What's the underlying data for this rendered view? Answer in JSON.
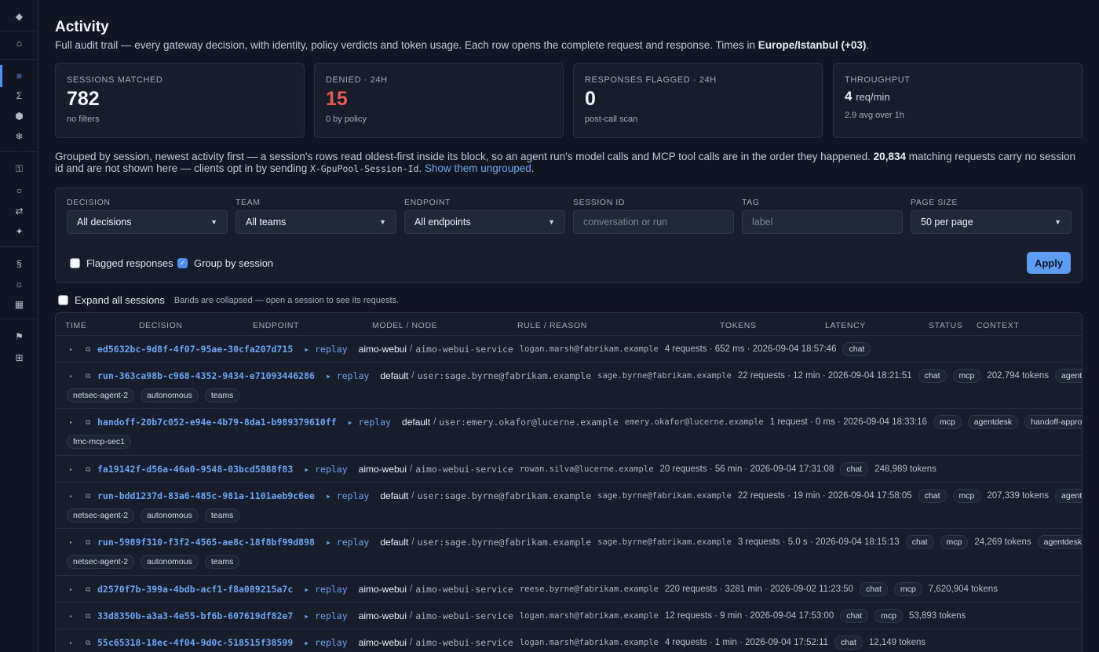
{
  "sidebar": {
    "icons": [
      "logo-icon",
      "home-icon",
      "activity-icon",
      "sigma-icon",
      "hexagon-icon",
      "gear-icon",
      "key-icon",
      "circle-icon",
      "swap-icon",
      "sparkle-icon",
      "section-icon",
      "settings-icon",
      "grid-icon",
      "flag-icon",
      "apps-icon"
    ],
    "glyphs": [
      "◆",
      "⌂",
      "≡",
      "Σ",
      "⬢",
      "❄",
      "⚿",
      "○",
      "⇄",
      "✦",
      "§",
      "☼",
      "▦",
      "⚑",
      "⊞"
    ]
  },
  "page": {
    "title": "Activity",
    "subtitle_main": "Full audit trail — every gateway decision, with identity, policy verdicts and token usage. Each row opens the complete request and response. Times in ",
    "subtitle_tz": "Europe/Istanbul (+03)",
    "subtitle_end": "."
  },
  "stats": [
    {
      "label": "SESSIONS MATCHED",
      "value": "782",
      "note": "no filters"
    },
    {
      "label": "DENIED · 24H",
      "value": "15",
      "note": "0 by policy"
    },
    {
      "label": "RESPONSES FLAGGED · 24H",
      "value": "0",
      "note": "post-call scan"
    },
    {
      "label": "THROUGHPUT",
      "value": "4",
      "unit": "req/min",
      "note": "2.9 avg over 1h"
    }
  ],
  "grouped": {
    "text1": "Grouped by session, newest activity first — a session's rows read oldest-first inside its block, so an agent run's model calls and MCP tool calls are in the order they happened. ",
    "count": "20,834",
    "text2": " matching requests carry no session id and are not shown here — clients opt in by sending ",
    "header": "X-GpuPool-Session-Id",
    "text3": ". ",
    "link": "Show them ungrouped",
    "text4": "."
  },
  "filters": {
    "decision": {
      "label": "DECISION",
      "value": "All decisions"
    },
    "team": {
      "label": "TEAM",
      "value": "All teams"
    },
    "endpoint": {
      "label": "ENDPOINT",
      "value": "All endpoints"
    },
    "session": {
      "label": "SESSION ID",
      "placeholder": "conversation or run"
    },
    "tag": {
      "label": "TAG",
      "placeholder": "label"
    },
    "page_size": {
      "label": "PAGE SIZE",
      "value": "50 per page"
    },
    "flagged_label": "Flagged responses",
    "flagged_checked": false,
    "group_label": "Group by session",
    "group_checked": true,
    "apply": "Apply"
  },
  "expand": {
    "label": "Expand all sessions",
    "note": "Bands are collapsed — open a session to see its requests."
  },
  "table": {
    "headers": [
      "TIME",
      "DECISION",
      "ENDPOINT",
      "MODEL / NODE",
      "RULE / REASON",
      "TOKENS",
      "LATENCY",
      "STATUS",
      "CONTEXT"
    ],
    "rows": [
      {
        "id": "ed5632bc-9d8f-4f07-95ae-30cfa207d715",
        "replay": "▸ replay",
        "model": "aimo-webui",
        "node": "aimo-webui-service",
        "email": "logan.marsh@fabrikam.example",
        "meta": "4 requests · 652 ms · 2026-09-04 18:57:46",
        "tags1": [
          "chat"
        ],
        "tokens": "",
        "tags1b": [],
        "tags2": []
      },
      {
        "id": "run-363ca98b-c968-4352-9434-e71093446286",
        "replay": "▸ replay",
        "model": "default",
        "node": "user:sage.byrne@fabrikam.example",
        "email": "sage.byrne@fabrikam.example",
        "meta": "22 requests · 12 min · 2026-09-04 18:21:51",
        "tags1": [
          "chat",
          "mcp"
        ],
        "tokens": "202,794 tokens",
        "tags1b": [
          "agentdesk"
        ],
        "tags2": [
          "netsec-agent-2",
          "autonomous",
          "teams"
        ]
      },
      {
        "id": "handoff-20b7c052-e94e-4b79-8da1-b989379610ff",
        "replay": "▸ replay",
        "model": "default",
        "node": "user:emery.okafor@lucerne.example",
        "email": "emery.okafor@lucerne.example",
        "meta": "1 request · 0 ms · 2026-09-04 18:33:16",
        "tags1": [
          "mcp",
          "agentdesk",
          "handoff-approve"
        ],
        "tokens": "",
        "tags1b": [],
        "tags2": [
          "fmc-mcp-sec1"
        ]
      },
      {
        "id": "fa19142f-d56a-46a0-9548-03bcd5888f83",
        "replay": "▸ replay",
        "model": "aimo-webui",
        "node": "aimo-webui-service",
        "email": "rowan.silva@lucerne.example",
        "meta": "20 requests · 56 min · 2026-09-04 17:31:08",
        "tags1": [
          "chat"
        ],
        "tokens": "248,989 tokens",
        "tags1b": [],
        "tags2": []
      },
      {
        "id": "run-bdd1237d-83a6-485c-981a-1101aeb9c6ee",
        "replay": "▸ replay",
        "model": "default",
        "node": "user:sage.byrne@fabrikam.example",
        "email": "sage.byrne@fabrikam.example",
        "meta": "22 requests · 19 min · 2026-09-04 17:58:05",
        "tags1": [
          "chat",
          "mcp"
        ],
        "tokens": "207,339 tokens",
        "tags1b": [
          "agentdesk"
        ],
        "tags2": [
          "netsec-agent-2",
          "autonomous",
          "teams"
        ]
      },
      {
        "id": "run-5989f310-f3f2-4565-ae8c-18f8bf99d898",
        "replay": "▸ replay",
        "model": "default",
        "node": "user:sage.byrne@fabrikam.example",
        "email": "sage.byrne@fabrikam.example",
        "meta": "3 requests · 5.0 s · 2026-09-04 18:15:13",
        "tags1": [
          "chat",
          "mcp"
        ],
        "tokens": "24,269 tokens",
        "tags1b": [
          "agentdesk"
        ],
        "tags2": [
          "netsec-agent-2",
          "autonomous",
          "teams"
        ]
      },
      {
        "id": "d2570f7b-399a-4bdb-acf1-f8a089215a7c",
        "replay": "▸ replay",
        "model": "aimo-webui",
        "node": "aimo-webui-service",
        "email": "reese.byrne@fabrikam.example",
        "meta": "220 requests · 3281 min · 2026-09-02 11:23:50",
        "tags1": [
          "chat",
          "mcp"
        ],
        "tokens": "7,620,904 tokens",
        "tags1b": [],
        "tags2": []
      },
      {
        "id": "33d8350b-a3a3-4e55-bf6b-607619df82e7",
        "replay": "▸ replay",
        "model": "aimo-webui",
        "node": "aimo-webui-service",
        "email": "logan.marsh@fabrikam.example",
        "meta": "12 requests · 9 min · 2026-09-04 17:53:00",
        "tags1": [
          "chat",
          "mcp"
        ],
        "tokens": "53,893 tokens",
        "tags1b": [],
        "tags2": []
      },
      {
        "id": "55c65318-18ec-4f04-9d0c-518515f38599",
        "replay": "▸ replay",
        "model": "aimo-webui",
        "node": "aimo-webui-service",
        "email": "logan.marsh@fabrikam.example",
        "meta": "4 requests · 1 min · 2026-09-04 17:52:11",
        "tags1": [
          "chat"
        ],
        "tokens": "12,149 tokens",
        "tags1b": [],
        "tags2": []
      }
    ]
  }
}
